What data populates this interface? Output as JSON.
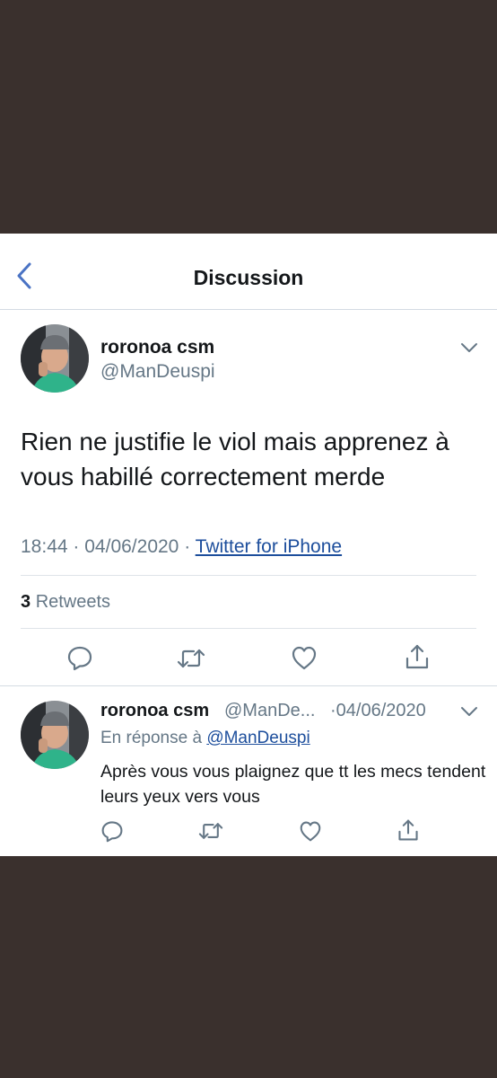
{
  "nav": {
    "title": "Discussion"
  },
  "main_tweet": {
    "name": "roronoa csm",
    "handle": "@ManDeuspi",
    "text": "Rien ne justifie le viol mais apprenez à vous habillé correctement merde",
    "time": "18:44",
    "date": "04/06/2020",
    "separator": "·",
    "source": "Twitter for iPhone",
    "retweets_count": "3",
    "retweets_label": "Retweets"
  },
  "reply_tweet": {
    "name": "roronoa csm",
    "handle": "@ManDe...",
    "date": "·04/06/2020",
    "reply_prefix": "En réponse à",
    "reply_to": "@ManDeuspi",
    "text": "Après vous vous plaignez que tt les mecs tendent leurs yeux vers vous"
  },
  "icons": [
    "back-arrow-icon",
    "chevron-down-icon",
    "reply-icon",
    "retweet-icon",
    "like-icon",
    "share-icon"
  ],
  "colors": {
    "accent": "#1d4e9c",
    "back_arrow": "#4a73c4",
    "secondary_text": "#657786",
    "primary_text": "#14171a",
    "backdrop": "#3a302d"
  }
}
